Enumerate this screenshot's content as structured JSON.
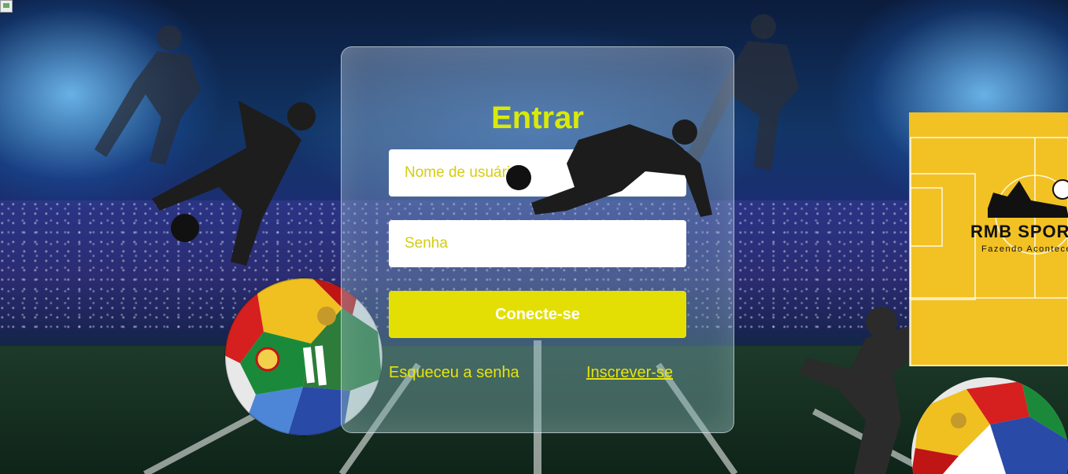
{
  "login": {
    "title": "Entrar",
    "username_placeholder": "Nome de usuário",
    "password_placeholder": "Senha",
    "submit_label": "Conecte-se",
    "forgot_link": "Esqueceu a senha",
    "signup_link": "Inscrever-se"
  },
  "logo": {
    "name": "RMB SPORTS",
    "tagline": "Fazendo Acontecer"
  },
  "colors": {
    "accent": "#d9ea0a",
    "button": "#e3df05",
    "logo_background": "#f2c124"
  }
}
